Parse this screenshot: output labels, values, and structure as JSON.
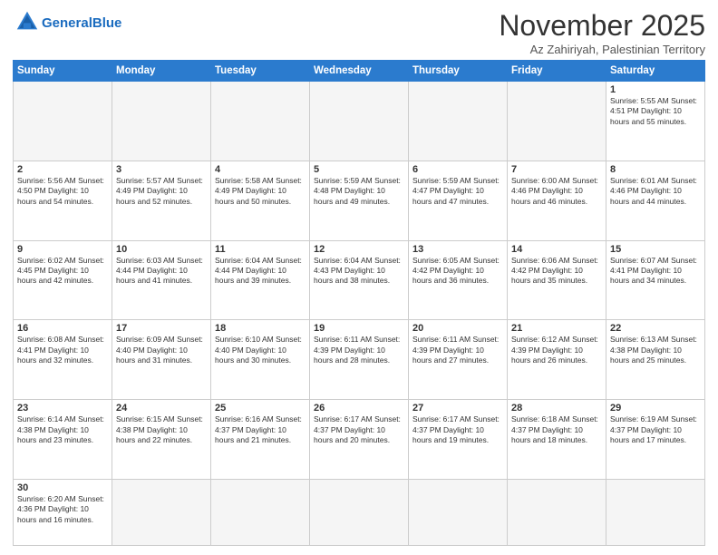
{
  "header": {
    "logo_general": "General",
    "logo_blue": "Blue",
    "month_title": "November 2025",
    "subtitle": "Az Zahiriyah, Palestinian Territory"
  },
  "days_of_week": [
    "Sunday",
    "Monday",
    "Tuesday",
    "Wednesday",
    "Thursday",
    "Friday",
    "Saturday"
  ],
  "weeks": [
    [
      {
        "day": "",
        "info": ""
      },
      {
        "day": "",
        "info": ""
      },
      {
        "day": "",
        "info": ""
      },
      {
        "day": "",
        "info": ""
      },
      {
        "day": "",
        "info": ""
      },
      {
        "day": "",
        "info": ""
      },
      {
        "day": "1",
        "info": "Sunrise: 5:55 AM\nSunset: 4:51 PM\nDaylight: 10 hours\nand 55 minutes."
      }
    ],
    [
      {
        "day": "2",
        "info": "Sunrise: 5:56 AM\nSunset: 4:50 PM\nDaylight: 10 hours\nand 54 minutes."
      },
      {
        "day": "3",
        "info": "Sunrise: 5:57 AM\nSunset: 4:49 PM\nDaylight: 10 hours\nand 52 minutes."
      },
      {
        "day": "4",
        "info": "Sunrise: 5:58 AM\nSunset: 4:49 PM\nDaylight: 10 hours\nand 50 minutes."
      },
      {
        "day": "5",
        "info": "Sunrise: 5:59 AM\nSunset: 4:48 PM\nDaylight: 10 hours\nand 49 minutes."
      },
      {
        "day": "6",
        "info": "Sunrise: 5:59 AM\nSunset: 4:47 PM\nDaylight: 10 hours\nand 47 minutes."
      },
      {
        "day": "7",
        "info": "Sunrise: 6:00 AM\nSunset: 4:46 PM\nDaylight: 10 hours\nand 46 minutes."
      },
      {
        "day": "8",
        "info": "Sunrise: 6:01 AM\nSunset: 4:46 PM\nDaylight: 10 hours\nand 44 minutes."
      }
    ],
    [
      {
        "day": "9",
        "info": "Sunrise: 6:02 AM\nSunset: 4:45 PM\nDaylight: 10 hours\nand 42 minutes."
      },
      {
        "day": "10",
        "info": "Sunrise: 6:03 AM\nSunset: 4:44 PM\nDaylight: 10 hours\nand 41 minutes."
      },
      {
        "day": "11",
        "info": "Sunrise: 6:04 AM\nSunset: 4:44 PM\nDaylight: 10 hours\nand 39 minutes."
      },
      {
        "day": "12",
        "info": "Sunrise: 6:04 AM\nSunset: 4:43 PM\nDaylight: 10 hours\nand 38 minutes."
      },
      {
        "day": "13",
        "info": "Sunrise: 6:05 AM\nSunset: 4:42 PM\nDaylight: 10 hours\nand 36 minutes."
      },
      {
        "day": "14",
        "info": "Sunrise: 6:06 AM\nSunset: 4:42 PM\nDaylight: 10 hours\nand 35 minutes."
      },
      {
        "day": "15",
        "info": "Sunrise: 6:07 AM\nSunset: 4:41 PM\nDaylight: 10 hours\nand 34 minutes."
      }
    ],
    [
      {
        "day": "16",
        "info": "Sunrise: 6:08 AM\nSunset: 4:41 PM\nDaylight: 10 hours\nand 32 minutes."
      },
      {
        "day": "17",
        "info": "Sunrise: 6:09 AM\nSunset: 4:40 PM\nDaylight: 10 hours\nand 31 minutes."
      },
      {
        "day": "18",
        "info": "Sunrise: 6:10 AM\nSunset: 4:40 PM\nDaylight: 10 hours\nand 30 minutes."
      },
      {
        "day": "19",
        "info": "Sunrise: 6:11 AM\nSunset: 4:39 PM\nDaylight: 10 hours\nand 28 minutes."
      },
      {
        "day": "20",
        "info": "Sunrise: 6:11 AM\nSunset: 4:39 PM\nDaylight: 10 hours\nand 27 minutes."
      },
      {
        "day": "21",
        "info": "Sunrise: 6:12 AM\nSunset: 4:39 PM\nDaylight: 10 hours\nand 26 minutes."
      },
      {
        "day": "22",
        "info": "Sunrise: 6:13 AM\nSunset: 4:38 PM\nDaylight: 10 hours\nand 25 minutes."
      }
    ],
    [
      {
        "day": "23",
        "info": "Sunrise: 6:14 AM\nSunset: 4:38 PM\nDaylight: 10 hours\nand 23 minutes."
      },
      {
        "day": "24",
        "info": "Sunrise: 6:15 AM\nSunset: 4:38 PM\nDaylight: 10 hours\nand 22 minutes."
      },
      {
        "day": "25",
        "info": "Sunrise: 6:16 AM\nSunset: 4:37 PM\nDaylight: 10 hours\nand 21 minutes."
      },
      {
        "day": "26",
        "info": "Sunrise: 6:17 AM\nSunset: 4:37 PM\nDaylight: 10 hours\nand 20 minutes."
      },
      {
        "day": "27",
        "info": "Sunrise: 6:17 AM\nSunset: 4:37 PM\nDaylight: 10 hours\nand 19 minutes."
      },
      {
        "day": "28",
        "info": "Sunrise: 6:18 AM\nSunset: 4:37 PM\nDaylight: 10 hours\nand 18 minutes."
      },
      {
        "day": "29",
        "info": "Sunrise: 6:19 AM\nSunset: 4:37 PM\nDaylight: 10 hours\nand 17 minutes."
      }
    ],
    [
      {
        "day": "30",
        "info": "Sunrise: 6:20 AM\nSunset: 4:36 PM\nDaylight: 10 hours\nand 16 minutes."
      },
      {
        "day": "",
        "info": ""
      },
      {
        "day": "",
        "info": ""
      },
      {
        "day": "",
        "info": ""
      },
      {
        "day": "",
        "info": ""
      },
      {
        "day": "",
        "info": ""
      },
      {
        "day": "",
        "info": ""
      }
    ]
  ]
}
